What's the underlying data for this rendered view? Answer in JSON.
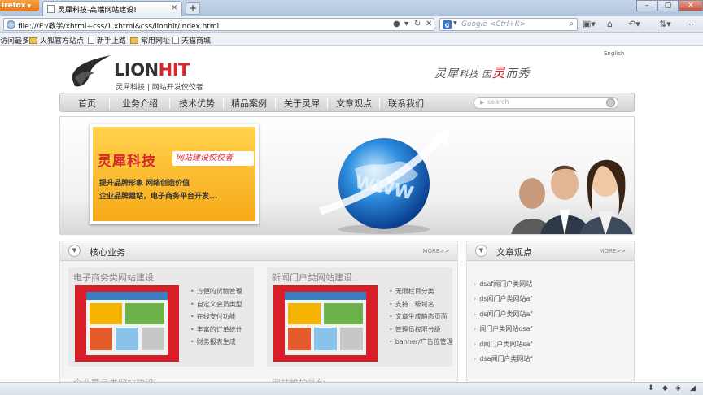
{
  "browser": {
    "firefox_button": "irefox",
    "tab_title": "灵犀科技-高端网站建设!",
    "url": "file:///E:/教学/xhtml+css/1.xhtml&css/lionhit/index.html",
    "search_placeholder": "Google <Ctrl+K>",
    "bookmarks": [
      "访问最多",
      "火狐官方站点",
      "新手上路",
      "常用网址",
      "天猫商城"
    ]
  },
  "site": {
    "logo": {
      "lion": "LION",
      "hit": "HIT",
      "subtitle": "灵犀科技 | 网站开发佼佼者"
    },
    "language": "English",
    "slogan": {
      "a": "灵犀",
      "b": "科技 因",
      "c": "灵",
      "d": "而秀"
    },
    "menu": [
      "首页",
      "业务介绍",
      "技术优势",
      "精品案例",
      "关于灵犀",
      "文章观点",
      "联系我们"
    ],
    "search_placeholder": "search",
    "banner": {
      "title": "灵犀科技",
      "tag": "网站建设佼佼者",
      "line1": "提升品牌形象  网络创造价值",
      "line2": "企业品牌建站，电子商务平台开发..."
    },
    "core": {
      "title": "核心业务",
      "more": "MORE>>",
      "cards": [
        {
          "title": "电子商务类网站建设",
          "items": [
            "方便的货物管理",
            "自定义会员类型",
            "在线支付功能",
            "丰富的订单统计",
            "财务报表生成"
          ]
        },
        {
          "title": "新闻门户类网站建设",
          "items": [
            "无限栏目分类",
            "支持二级域名",
            "文章生成静态页面",
            "管理员权限分级",
            "banner/广告位管理"
          ]
        }
      ],
      "partial_left": "企业展示类网站建设",
      "partial_right": "网站维护外包"
    },
    "articles": {
      "title": "文章观点",
      "more": "MORE>>",
      "items": [
        "dsaf闻门户类网站",
        "ds闻门户类网站af",
        "ds闻门户类网站af",
        "闻门户类网站dsaf",
        "d闻门户类网站saf",
        "dsa闻门户类网站f"
      ]
    }
  }
}
